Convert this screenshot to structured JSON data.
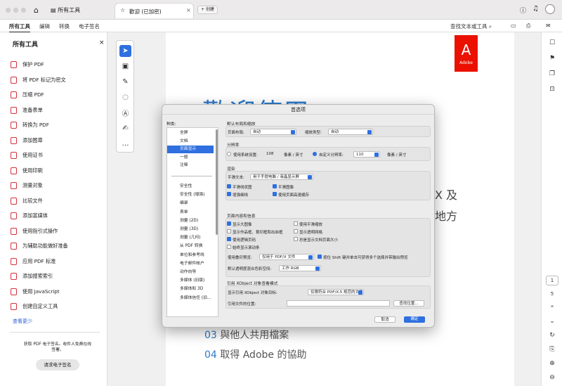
{
  "tabbar": {
    "home_tab": "所有工具",
    "doc_tab": "歡迎 (已加密)",
    "new_tab": "创建"
  },
  "menubar": {
    "items": [
      "所有工具",
      "编辑",
      "转换",
      "电子签名"
    ],
    "search": "查找文本或工具"
  },
  "sidebar": {
    "title": "所有工具",
    "tools": [
      "保护 PDF",
      "将 PDF 标记为密文",
      "压缩 PDF",
      "准备表单",
      "转换为 PDF",
      "添加图章",
      "使用证书",
      "使用印刷",
      "测量对象",
      "比较文件",
      "添加富媒体",
      "使用指引式操作",
      "为辅助功能做好准备",
      "应用 PDF 标准",
      "添加搜索索引",
      "使用 JavaScript",
      "创建自定义工具"
    ],
    "see_less": "查看更少",
    "promo_text": "获取 PDF 电子签名。收件人免费在线签署。",
    "promo_button": "请求电子签名"
  },
  "document": {
    "heading": "歡迎使用",
    "text_a": "X 及",
    "text_b": "地方",
    "item3_num": "03",
    "item3": "與他人共用檔案",
    "item4_num": "04",
    "item4": "取得 Adobe 的協助",
    "logo_text": "Adobe"
  },
  "rightbar": {
    "page_number": "1",
    "page_count": "5"
  },
  "dialog": {
    "title": "首选项",
    "categories_label": "种类:",
    "categories_top": [
      "全屏",
      "文档",
      "页面显示",
      "一般",
      "注释"
    ],
    "categories_bottom": [
      "安全性",
      "安全性 (增强)",
      "编录",
      "表单",
      "测量 (2D)",
      "测量 (3D)",
      "测量 (几何)",
      "从 PDF 转换",
      "单位和参考线",
      "电子邮件帐户",
      "动作向导",
      "多媒体 (旧版)",
      "多媒体和 3D",
      "多媒体信任 (旧..."
    ],
    "layout": {
      "title": "默认布局和缩放",
      "page_layout_label": "页面布局:",
      "page_layout": "自动",
      "zoom_label": "缩放类型:",
      "zoom": "自动"
    },
    "resolution": {
      "title": "分辨率",
      "system_label": "使用系统设置:",
      "system_value": "108",
      "unit1": "像素 / 英寸",
      "custom_label": "自定义分辨率:",
      "custom_value": "110",
      "unit2": "像素 / 英寸"
    },
    "render": {
      "title": "渲染",
      "smooth_text_label": "平滑文本:",
      "smooth_text": "用于手提电脑 / 液晶显示屏",
      "opts": [
        "平滑线状图",
        "平滑图像",
        "增强细线",
        "使用页面高速缓存"
      ]
    },
    "content": {
      "title": "页面内容和信息",
      "opts": [
        "显示大图像",
        "使用平滑缩放",
        "显示作品框、裁切框和出血框",
        "显示透明网格",
        "使用逻辑页码",
        "总是显示文档页面大小",
        "始终显示滚动条"
      ],
      "overprint_label": "使用叠印预览:",
      "overprint": "仅用于 PDF/X 文件",
      "shift_label": "按住 Shift 键并单击可获得多个选择并带输出预览",
      "blend_label": "默认透明度混合色彩空间:",
      "blend": "工作 RGB"
    },
    "xobject": {
      "title": "引用 XObject 对象查看模式",
      "target_label": "显示引用 XObject 对象目标:",
      "target": "仅限符合 PDF/X-5 规范的文件",
      "location_label": "引用文件的位置:",
      "browse": "查找位置..."
    },
    "cancel": "取消",
    "ok": "确定"
  }
}
